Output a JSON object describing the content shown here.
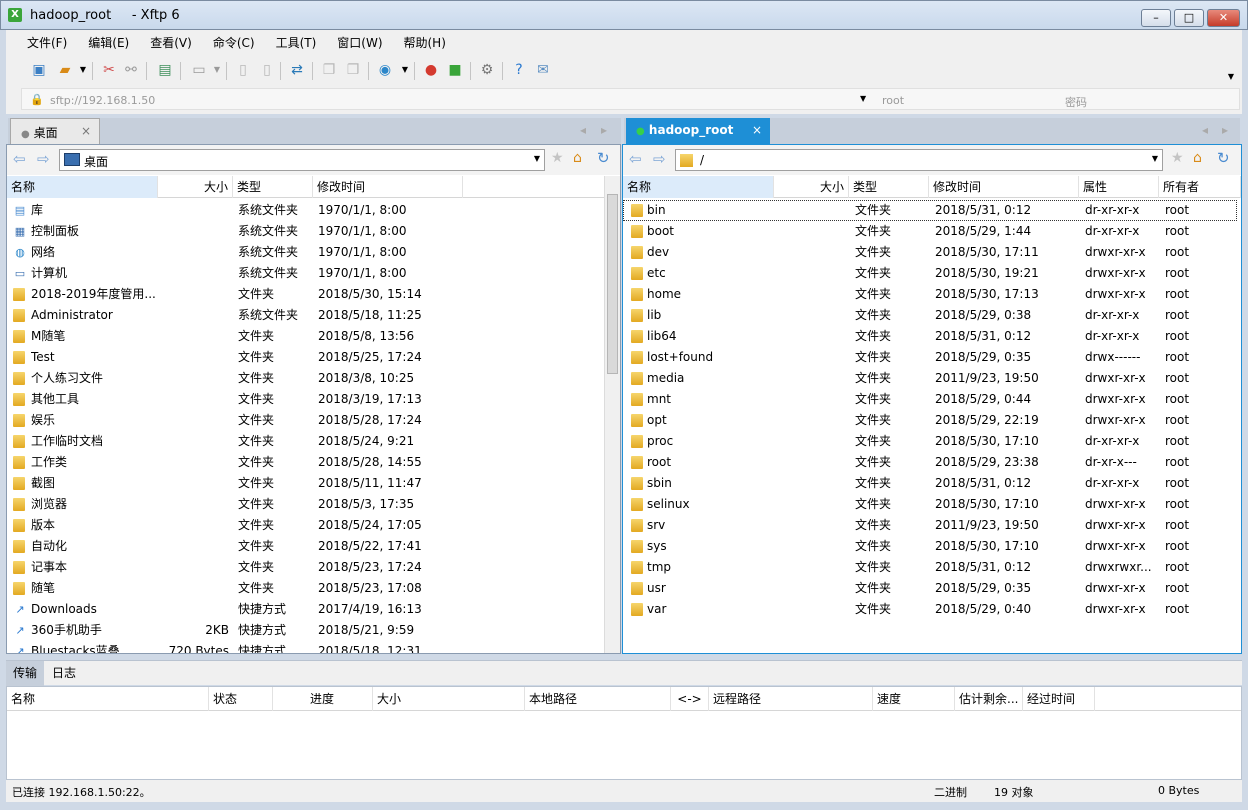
{
  "window": {
    "title": "hadoop_root     - Xftp 6",
    "app_icon": "xftp-app-icon",
    "minimize": "minimize-icon",
    "maximize": "maximize-icon",
    "close": "close-icon"
  },
  "menu": [
    "文件(F)",
    "编辑(E)",
    "查看(V)",
    "命令(C)",
    "工具(T)",
    "窗口(W)",
    "帮助(H)"
  ],
  "toolbar_icons": [
    "new-session-icon",
    "open-folder-icon",
    "dropdown-icon",
    "disconnect-icon",
    "reconnect-icon",
    "properties-icon",
    "view-icon",
    "dropdown-icon",
    "copy-icon",
    "paste-icon",
    "transfer-icon",
    "new-window-icon",
    "cascade-icon",
    "globe-icon",
    "dropdown-icon",
    "xshell-icon",
    "xftp-icon",
    "settings-icon",
    "help-icon",
    "chat-icon"
  ],
  "address": {
    "host": "sftp://192.168.1.50",
    "user": "root",
    "password_placeholder": "密码"
  },
  "left": {
    "tab": "桌面",
    "tab_close": "×",
    "path": "桌面",
    "columns": [
      "名称",
      "大小",
      "类型",
      "修改时间"
    ],
    "rows": [
      {
        "name": "库",
        "size": "",
        "type": "系统文件夹",
        "mtime": "1970/1/1, 8:00",
        "icon": "library-icon"
      },
      {
        "name": "控制面板",
        "size": "",
        "type": "系统文件夹",
        "mtime": "1970/1/1, 8:00",
        "icon": "control-panel-icon"
      },
      {
        "name": "网络",
        "size": "",
        "type": "系统文件夹",
        "mtime": "1970/1/1, 8:00",
        "icon": "network-icon"
      },
      {
        "name": "计算机",
        "size": "",
        "type": "系统文件夹",
        "mtime": "1970/1/1, 8:00",
        "icon": "computer-icon"
      },
      {
        "name": "2018-2019年度管用...",
        "size": "",
        "type": "文件夹",
        "mtime": "2018/5/30, 15:14",
        "icon": "folder-icon"
      },
      {
        "name": "Administrator",
        "size": "",
        "type": "系统文件夹",
        "mtime": "2018/5/18, 11:25",
        "icon": "user-folder-icon"
      },
      {
        "name": "M随笔",
        "size": "",
        "type": "文件夹",
        "mtime": "2018/5/8, 13:56",
        "icon": "folder-icon"
      },
      {
        "name": "Test",
        "size": "",
        "type": "文件夹",
        "mtime": "2018/5/25, 17:24",
        "icon": "folder-icon"
      },
      {
        "name": "个人练习文件",
        "size": "",
        "type": "文件夹",
        "mtime": "2018/3/8, 10:25",
        "icon": "folder-icon"
      },
      {
        "name": "其他工具",
        "size": "",
        "type": "文件夹",
        "mtime": "2018/3/19, 17:13",
        "icon": "folder-icon"
      },
      {
        "name": "娱乐",
        "size": "",
        "type": "文件夹",
        "mtime": "2018/5/28, 17:24",
        "icon": "folder-icon"
      },
      {
        "name": "工作临时文档",
        "size": "",
        "type": "文件夹",
        "mtime": "2018/5/24, 9:21",
        "icon": "folder-icon"
      },
      {
        "name": "工作类",
        "size": "",
        "type": "文件夹",
        "mtime": "2018/5/28, 14:55",
        "icon": "folder-icon"
      },
      {
        "name": "截图",
        "size": "",
        "type": "文件夹",
        "mtime": "2018/5/11, 11:47",
        "icon": "folder-icon"
      },
      {
        "name": "浏览器",
        "size": "",
        "type": "文件夹",
        "mtime": "2018/5/3, 17:35",
        "icon": "folder-icon"
      },
      {
        "name": "版本",
        "size": "",
        "type": "文件夹",
        "mtime": "2018/5/24, 17:05",
        "icon": "folder-icon"
      },
      {
        "name": "自动化",
        "size": "",
        "type": "文件夹",
        "mtime": "2018/5/22, 17:41",
        "icon": "folder-icon"
      },
      {
        "name": "记事本",
        "size": "",
        "type": "文件夹",
        "mtime": "2018/5/23, 17:24",
        "icon": "folder-icon"
      },
      {
        "name": "随笔",
        "size": "",
        "type": "文件夹",
        "mtime": "2018/5/23, 17:08",
        "icon": "folder-icon"
      },
      {
        "name": "Downloads",
        "size": "",
        "type": "快捷方式",
        "mtime": "2017/4/19, 16:13",
        "icon": "shortcut-icon"
      },
      {
        "name": "360手机助手",
        "size": "2KB",
        "type": "快捷方式",
        "mtime": "2018/5/21, 9:59",
        "icon": "shortcut-icon"
      },
      {
        "name": "Bluestacks蓝叠",
        "size": "720 Bytes",
        "type": "快捷方式",
        "mtime": "2018/5/18, 12:31",
        "icon": "shortcut-icon"
      }
    ]
  },
  "right": {
    "tab": "hadoop_root",
    "tab_close": "×",
    "path": "/",
    "columns": [
      "名称",
      "大小",
      "类型",
      "修改时间",
      "属性",
      "所有者"
    ],
    "rows": [
      {
        "name": "bin",
        "type": "文件夹",
        "mtime": "2018/5/31, 0:12",
        "perm": "dr-xr-xr-x",
        "owner": "root"
      },
      {
        "name": "boot",
        "type": "文件夹",
        "mtime": "2018/5/29, 1:44",
        "perm": "dr-xr-xr-x",
        "owner": "root"
      },
      {
        "name": "dev",
        "type": "文件夹",
        "mtime": "2018/5/30, 17:11",
        "perm": "drwxr-xr-x",
        "owner": "root"
      },
      {
        "name": "etc",
        "type": "文件夹",
        "mtime": "2018/5/30, 19:21",
        "perm": "drwxr-xr-x",
        "owner": "root"
      },
      {
        "name": "home",
        "type": "文件夹",
        "mtime": "2018/5/30, 17:13",
        "perm": "drwxr-xr-x",
        "owner": "root"
      },
      {
        "name": "lib",
        "type": "文件夹",
        "mtime": "2018/5/29, 0:38",
        "perm": "dr-xr-xr-x",
        "owner": "root"
      },
      {
        "name": "lib64",
        "type": "文件夹",
        "mtime": "2018/5/31, 0:12",
        "perm": "dr-xr-xr-x",
        "owner": "root"
      },
      {
        "name": "lost+found",
        "type": "文件夹",
        "mtime": "2018/5/29, 0:35",
        "perm": "drwx------",
        "owner": "root"
      },
      {
        "name": "media",
        "type": "文件夹",
        "mtime": "2011/9/23, 19:50",
        "perm": "drwxr-xr-x",
        "owner": "root"
      },
      {
        "name": "mnt",
        "type": "文件夹",
        "mtime": "2018/5/29, 0:44",
        "perm": "drwxr-xr-x",
        "owner": "root"
      },
      {
        "name": "opt",
        "type": "文件夹",
        "mtime": "2018/5/29, 22:19",
        "perm": "drwxr-xr-x",
        "owner": "root"
      },
      {
        "name": "proc",
        "type": "文件夹",
        "mtime": "2018/5/30, 17:10",
        "perm": "dr-xr-xr-x",
        "owner": "root"
      },
      {
        "name": "root",
        "type": "文件夹",
        "mtime": "2018/5/29, 23:38",
        "perm": "dr-xr-x---",
        "owner": "root"
      },
      {
        "name": "sbin",
        "type": "文件夹",
        "mtime": "2018/5/31, 0:12",
        "perm": "dr-xr-xr-x",
        "owner": "root"
      },
      {
        "name": "selinux",
        "type": "文件夹",
        "mtime": "2018/5/30, 17:10",
        "perm": "drwxr-xr-x",
        "owner": "root"
      },
      {
        "name": "srv",
        "type": "文件夹",
        "mtime": "2011/9/23, 19:50",
        "perm": "drwxr-xr-x",
        "owner": "root"
      },
      {
        "name": "sys",
        "type": "文件夹",
        "mtime": "2018/5/30, 17:10",
        "perm": "drwxr-xr-x",
        "owner": "root"
      },
      {
        "name": "tmp",
        "type": "文件夹",
        "mtime": "2018/5/31, 0:12",
        "perm": "drwxrwxr...",
        "owner": "root"
      },
      {
        "name": "usr",
        "type": "文件夹",
        "mtime": "2018/5/29, 0:35",
        "perm": "drwxr-xr-x",
        "owner": "root"
      },
      {
        "name": "var",
        "type": "文件夹",
        "mtime": "2018/5/29, 0:40",
        "perm": "drwxr-xr-x",
        "owner": "root"
      }
    ]
  },
  "transfer": {
    "tabs": [
      "传输",
      "日志"
    ],
    "columns": [
      "名称",
      "状态",
      "进度",
      "大小",
      "本地路径",
      "<->",
      "远程路径",
      "速度",
      "估计剩余...",
      "经过时间"
    ]
  },
  "status": {
    "connection": "已连接 192.168.1.50:22。",
    "mode": "二进制",
    "objects": "19 对象",
    "bytes": "0 Bytes"
  },
  "colors": {
    "active_tab": "#1e8fd6",
    "selection": "#dff0ff",
    "accent": "#3b8a3b"
  }
}
